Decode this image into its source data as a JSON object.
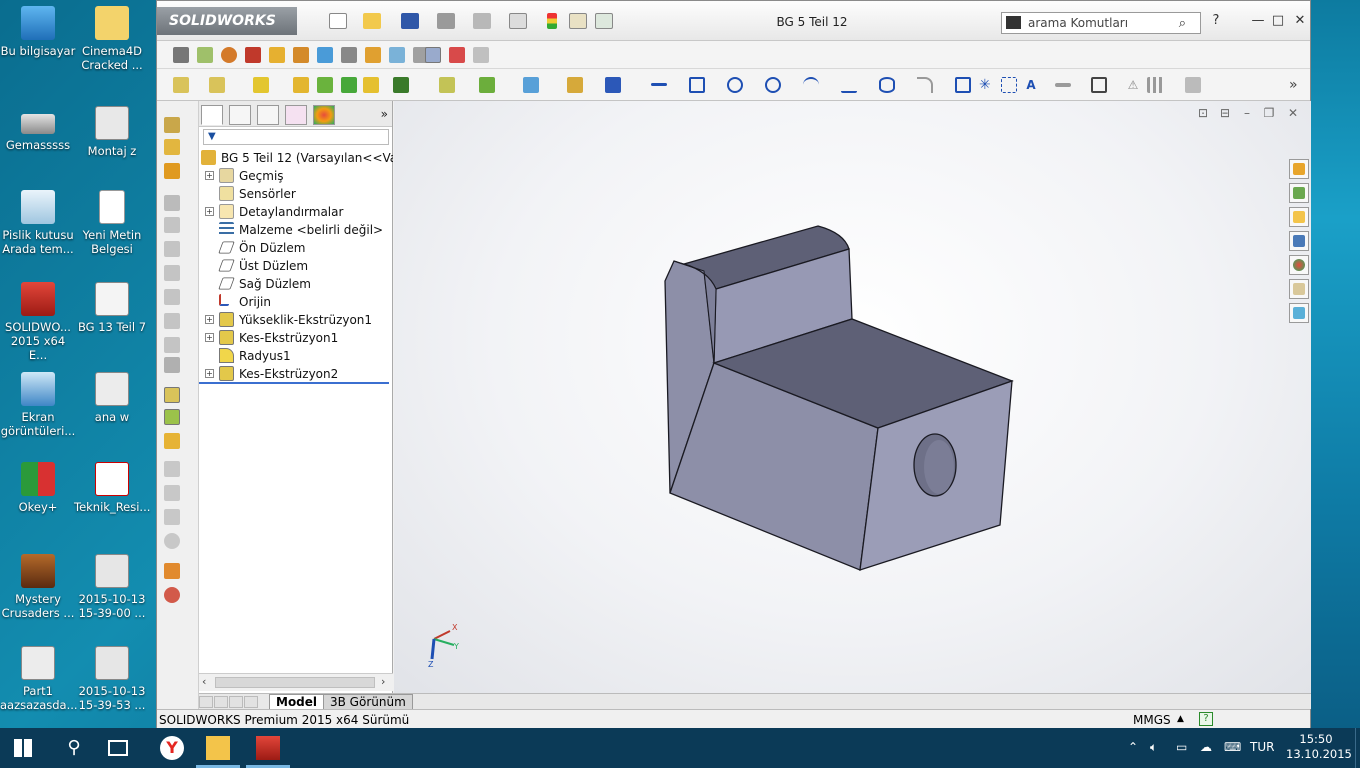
{
  "desktop": {
    "icons": [
      {
        "label": "Bu bilgisayar"
      },
      {
        "label": "Cinema4D Cracked ..."
      },
      {
        "label": "Gemasssss"
      },
      {
        "label": "Montaj z"
      },
      {
        "label": "Pislik kutusu Arada tem..."
      },
      {
        "label": "Yeni Metin Belgesi"
      },
      {
        "label": "SOLIDWO... 2015 x64 E..."
      },
      {
        "label": "BG 13 Teil 7"
      },
      {
        "label": "Ekran görüntüleri..."
      },
      {
        "label": "ana w"
      },
      {
        "label": "Okey+"
      },
      {
        "label": "Teknik_Resi..."
      },
      {
        "label": "Mystery Crusaders ..."
      },
      {
        "label": "2015-10-13 15-39-00 ..."
      },
      {
        "label": "Part1 aazsazasda..."
      },
      {
        "label": "2015-10-13 15-39-53 ..."
      }
    ]
  },
  "app": {
    "logo": "SOLIDWORKS",
    "doc_title": "BG 5 Teil 12",
    "search_placeholder": "arama Komutları",
    "help": "?"
  },
  "feature_manager": {
    "root": "BG 5 Teil 12  (Varsayılan<<Varsa",
    "items": [
      {
        "label": "Geçmiş",
        "expandable": true
      },
      {
        "label": "Sensörler",
        "expandable": false
      },
      {
        "label": "Detaylandırmalar",
        "expandable": true
      },
      {
        "label": "Malzeme <belirli değil>",
        "expandable": false
      },
      {
        "label": "Ön Düzlem",
        "expandable": false
      },
      {
        "label": "Üst Düzlem",
        "expandable": false
      },
      {
        "label": "Sağ Düzlem",
        "expandable": false
      },
      {
        "label": "Orijin",
        "expandable": false
      },
      {
        "label": "Yükseklik-Ekstrüzyon1",
        "expandable": true
      },
      {
        "label": "Kes-Ekstrüzyon1",
        "expandable": true
      },
      {
        "label": "Radyus1",
        "expandable": false
      },
      {
        "label": "Kes-Ekstrüzyon2",
        "expandable": true
      }
    ]
  },
  "bottom_tabs": {
    "model": "Model",
    "view3d": "3B Görünüm"
  },
  "status": {
    "product": "SOLIDWORKS Premium 2015 x64 Sürümü",
    "units": "MMGS"
  },
  "taskbar": {
    "lang": "TUR",
    "time": "15:50",
    "date": "13.10.2015"
  },
  "colors": {
    "part_top": "#5e6076",
    "part_side": "#8d8fa8",
    "part_front": "#9b9db7",
    "accent_blue": "#1e4fb3"
  }
}
